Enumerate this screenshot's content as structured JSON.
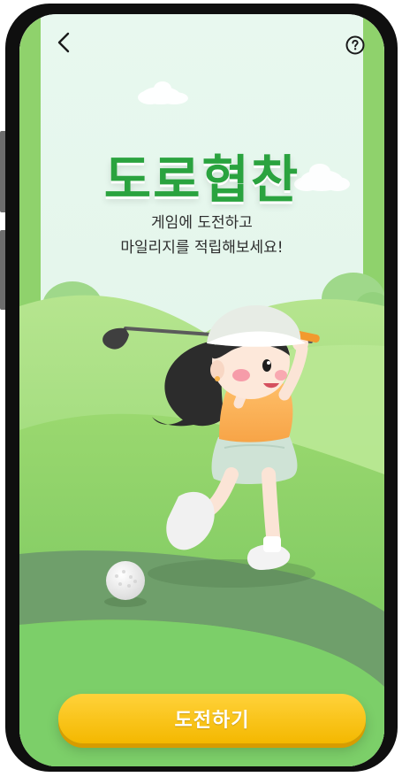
{
  "header": {
    "back_icon": "chevron-left-icon",
    "help_icon": "question-circle-icon"
  },
  "hero": {
    "title": "도로협찬",
    "subtitle_line1": "게임에 도전하고",
    "subtitle_line2": "마일리지를 적립해보세요!"
  },
  "cta": {
    "label": "도전하기"
  },
  "colors": {
    "title_green": "#2aa33f",
    "cta_yellow": "#f4b800",
    "grass_green": "#7ccf69"
  }
}
